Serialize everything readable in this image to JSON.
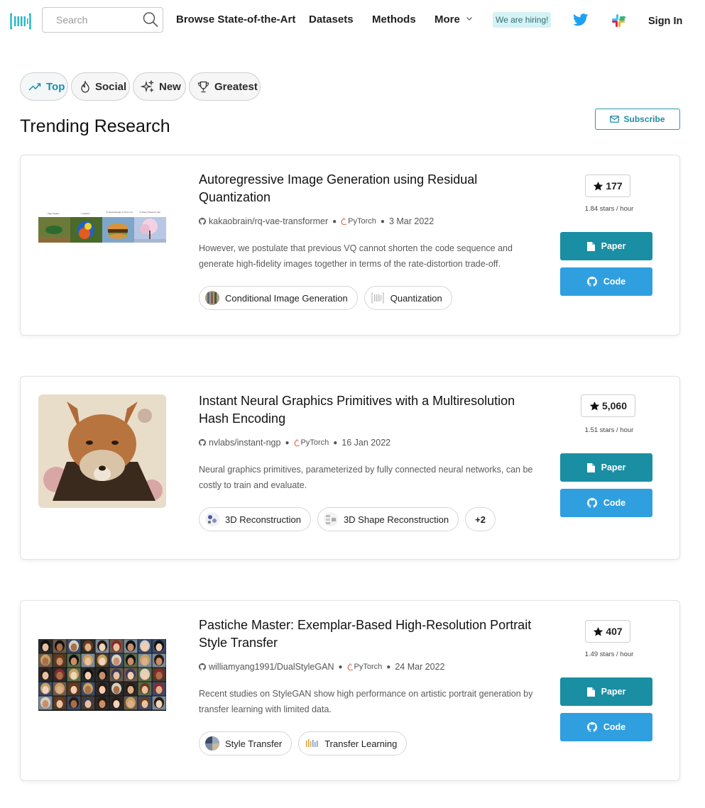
{
  "nav": {
    "search_placeholder": "Search",
    "links": [
      "Browse State-of-the-Art",
      "Datasets",
      "Methods",
      "More"
    ],
    "hiring": "We are hiring!",
    "sign_in": "Sign In"
  },
  "filters": [
    "Top",
    "Social",
    "New",
    "Greatest"
  ],
  "active_filter": "Top",
  "page_title": "Trending Research",
  "subscribe_label": "Subscribe",
  "colors": {
    "accent": "#1a8ea2",
    "code_button": "#2f9fe0",
    "hiring_bg": "#d5f2f5"
  },
  "papers": [
    {
      "title": "Autoregressive Image Generation using Residual Quantization",
      "repo": "kakaobrain/rq-vae-transformer",
      "framework": "PyTorch",
      "date": "3 Mar 2022",
      "abstract": "However, we postulate that previous VQ cannot shorten the code sequence and generate high-fidelity images together in terms of the rate-distortion trade-off.",
      "tags": [
        "Conditional Image Generation",
        "Quantization"
      ],
      "more_tags": "",
      "stars": "177",
      "stars_rate": "1.84 stars / hour",
      "paper_label": "Paper",
      "code_label": "Code"
    },
    {
      "title": "Instant Neural Graphics Primitives with a Multiresolution Hash Encoding",
      "repo": "nvlabs/instant-ngp",
      "framework": "PyTorch",
      "date": "16 Jan 2022",
      "abstract": "Neural graphics primitives, parameterized by fully connected neural networks, can be costly to train and evaluate.",
      "tags": [
        "3D Reconstruction",
        "3D Shape Reconstruction"
      ],
      "more_tags": "+2",
      "stars": "5,060",
      "stars_rate": "1.51 stars / hour",
      "paper_label": "Paper",
      "code_label": "Code"
    },
    {
      "title": "Pastiche Master: Exemplar-Based High-Resolution Portrait Style Transfer",
      "repo": "williamyang1991/DualStyleGAN",
      "framework": "PyTorch",
      "date": "24 Mar 2022",
      "abstract": "Recent studies on StyleGAN show high performance on artistic portrait generation by transfer learning with limited data.",
      "tags": [
        "Style Transfer",
        "Transfer Learning"
      ],
      "more_tags": "",
      "stars": "407",
      "stars_rate": "1.49 stars / hour",
      "paper_label": "Paper",
      "code_label": "Code"
    }
  ]
}
